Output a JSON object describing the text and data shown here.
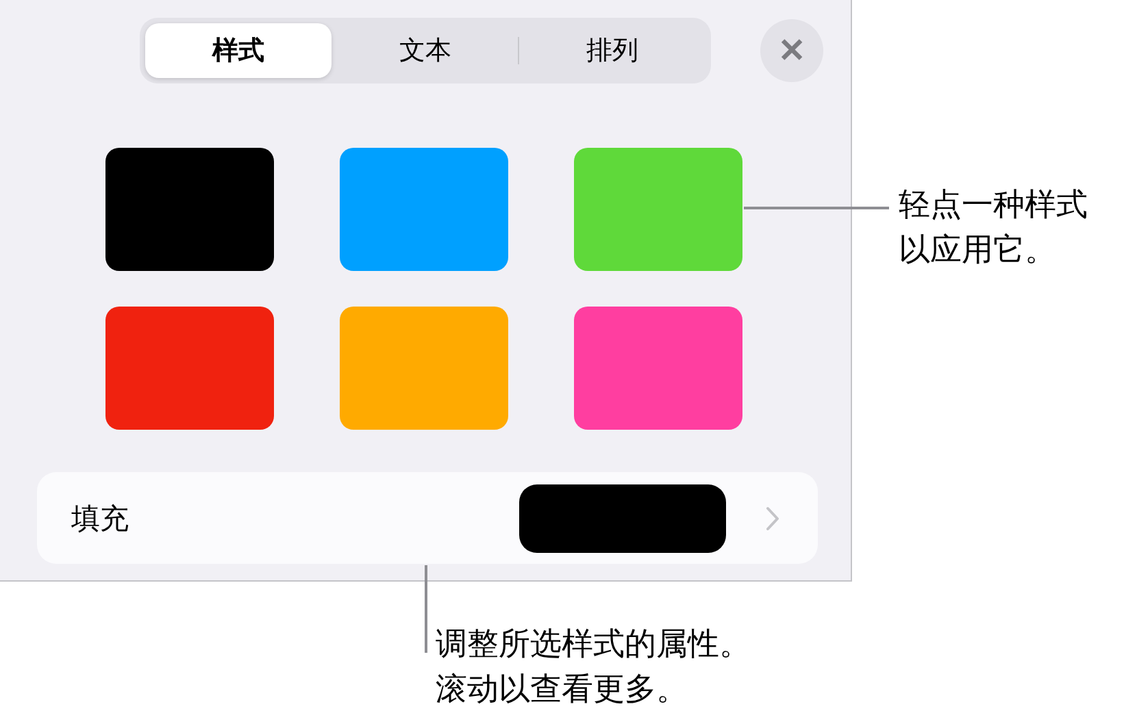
{
  "tabs": [
    {
      "label": "样式",
      "selected": true
    },
    {
      "label": "文本",
      "selected": false
    },
    {
      "label": "排列",
      "selected": false
    }
  ],
  "close_button": {
    "label": "✕"
  },
  "swatches": [
    {
      "color": "#000000"
    },
    {
      "color": "#00a0ff"
    },
    {
      "color": "#5fd93a"
    },
    {
      "color": "#f0220f"
    },
    {
      "color": "#ffaa00"
    },
    {
      "color": "#ff3ea0"
    }
  ],
  "fill_row": {
    "label": "填充",
    "color": "#000000"
  },
  "callouts": [
    {
      "kind": "right",
      "lines": [
        "轻点一种样式",
        "以应用它。"
      ]
    },
    {
      "kind": "bottom",
      "lines": [
        "调整所选样式的属性。",
        "滚动以查看更多。"
      ]
    }
  ]
}
